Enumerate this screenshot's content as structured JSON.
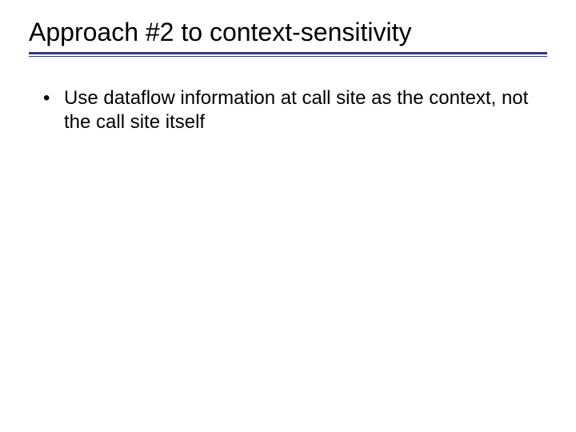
{
  "slide": {
    "title": "Approach #2 to context-sensitivity",
    "bullets": [
      "Use dataflow information at call site as the context, not the call site itself"
    ]
  }
}
